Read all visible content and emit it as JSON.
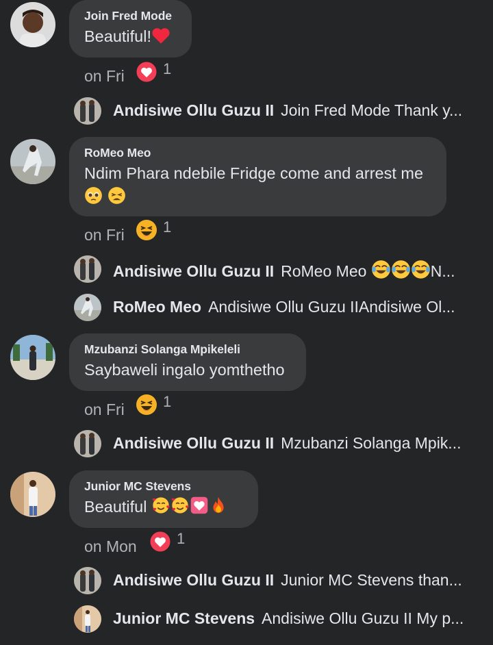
{
  "comments": [
    {
      "author": "Join Fred Mode",
      "text": "Beautiful!",
      "time": "on Fri",
      "reaction_count": "1",
      "reaction_icon": "love-icon",
      "replies": [
        {
          "author": "Andisiwe Ollu Guzu II",
          "preview": "Join Fred Mode Thank y..."
        }
      ]
    },
    {
      "author": "RoMeo Meo",
      "text": "Ndim Phara ndebile Fridge come and arrest me",
      "time": "on Fri",
      "reaction_count": "1",
      "reaction_icon": "haha-icon",
      "replies": [
        {
          "author": "Andisiwe Ollu Guzu II",
          "preview": "RoMeo Meo",
          "preview_suffix": "N..."
        },
        {
          "author": "RoMeo Meo",
          "preview": "Andisiwe Ollu Guzu IIAndisiwe Ol..."
        }
      ]
    },
    {
      "author": "Mzubanzi Solanga Mpikeleli",
      "text": "Saybaweli ingalo yomthetho",
      "time": "on Fri",
      "reaction_count": "1",
      "reaction_icon": "haha-icon",
      "replies": [
        {
          "author": "Andisiwe Ollu Guzu II",
          "preview": "Mzubanzi Solanga Mpik..."
        }
      ]
    },
    {
      "author": "Junior MC Stevens",
      "text": "Beautiful",
      "time": "on Mon",
      "reaction_count": "1",
      "reaction_icon": "love-icon",
      "replies": [
        {
          "author": "Andisiwe Ollu Guzu II",
          "preview": "Junior MC Stevens than..."
        },
        {
          "author": "Junior MC Stevens",
          "preview": "Andisiwe Ollu Guzu II My p..."
        }
      ]
    }
  ],
  "colors": {
    "background": "#242526",
    "bubble": "#3a3b3c",
    "primary_text": "#e4e6eb",
    "secondary_text": "#b0b3b8",
    "love": "#f33e58",
    "haha": "#f7b125"
  }
}
